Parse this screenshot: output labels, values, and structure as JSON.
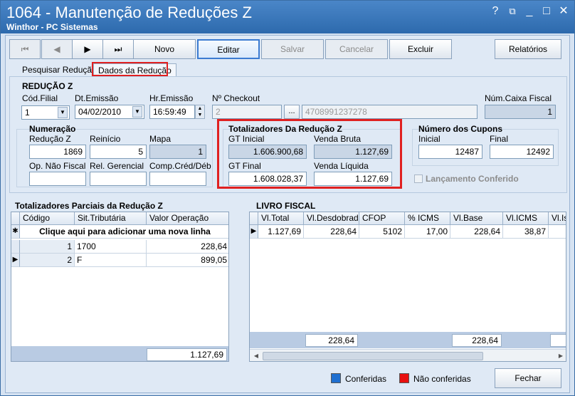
{
  "window": {
    "title": "1064 - Manutenção de Reduções Z",
    "subtitle": "Winthor - PC Sistemas",
    "controls": [
      "?",
      "⧉",
      "_",
      "□",
      "✕"
    ]
  },
  "toolbar": {
    "nav_first": "⏮",
    "nav_prev": "◀",
    "nav_next": "▶",
    "nav_last": "⏭",
    "novo": "Novo",
    "editar": "Editar",
    "salvar": "Salvar",
    "cancelar": "Cancelar",
    "excluir": "Excluir",
    "relatorios": "Relatórios"
  },
  "tabs": {
    "pesquisar": "Pesquisar Redução",
    "dados": "Dados da Redução"
  },
  "reducao": {
    "section": "REDUÇÃO Z",
    "cod_filial_label": "Cód.Filial",
    "cod_filial_value": "1",
    "dt_emissao_label": "Dt.Emissão",
    "dt_emissao_value": "04/02/2010",
    "hr_emissao_label": "Hr.Emissão",
    "hr_emissao_value": "16:59:49",
    "checkout_label": "Nº Checkout",
    "checkout_value": "2",
    "checkout_btn": "...",
    "checkout_desc": "4708991237278",
    "num_caixa_label": "Núm.Caixa Fiscal",
    "num_caixa_value": "1"
  },
  "numeracao": {
    "title": "Numeração",
    "reducao_label": "Redução Z",
    "reducao_value": "1869",
    "reinicio_label": "Reinício",
    "reinicio_value": "5",
    "mapa_label": "Mapa",
    "mapa_value": "1",
    "op_nao_fiscal_label": "Op. Não Fiscal",
    "rel_gerencial_label": "Rel. Gerencial",
    "comp_cred_label": "Comp.Créd/Déb"
  },
  "totalizadores": {
    "title": "Totalizadores Da Redução Z",
    "gt_inicial_label": "GT Inicial",
    "gt_inicial_value": "1.606.900,68",
    "venda_bruta_label": "Venda Bruta",
    "venda_bruta_value": "1.127,69",
    "gt_final_label": "GT Final",
    "gt_final_value": "1.608.028,37",
    "venda_liquida_label": "Venda Líquida",
    "venda_liquida_value": "1.127,69"
  },
  "cupons": {
    "title": "Número dos Cupons",
    "inicial_label": "Inicial",
    "inicial_value": "12487",
    "final_label": "Final",
    "final_value": "12492",
    "lancamento_label": "Lançamento Conferido"
  },
  "parciais": {
    "title": "Totalizadores Parciais da Redução Z",
    "columns": [
      "Código",
      "Sit.Tributária",
      "Valor Operação"
    ],
    "new_row": "Clique aqui para adicionar uma nova linha",
    "rows": [
      {
        "codigo": "1",
        "sit": "1700",
        "valor": "228,64"
      },
      {
        "codigo": "2",
        "sit": "F",
        "valor": "899,05"
      }
    ],
    "total": "1.127,69"
  },
  "livro": {
    "title": "LIVRO FISCAL",
    "columns": [
      "Vl.Total",
      "Vl.Desdobrado",
      "CFOP",
      "% ICMS",
      "Vl.Base",
      "Vl.ICMS",
      "Vl.Is"
    ],
    "rows": [
      {
        "total": "1.127,69",
        "desdobrado": "228,64",
        "cfop": "5102",
        "icms_pct": "17,00",
        "base": "228,64",
        "icms": "38,87"
      }
    ],
    "footer_desdobrado": "228,64",
    "footer_base": "228,64"
  },
  "footer": {
    "conferidas": "Conferidas",
    "nao_conferidas": "Não conferidas",
    "fechar": "Fechar",
    "color_conferidas": "#1f6fd0",
    "color_nao": "#e81010"
  }
}
